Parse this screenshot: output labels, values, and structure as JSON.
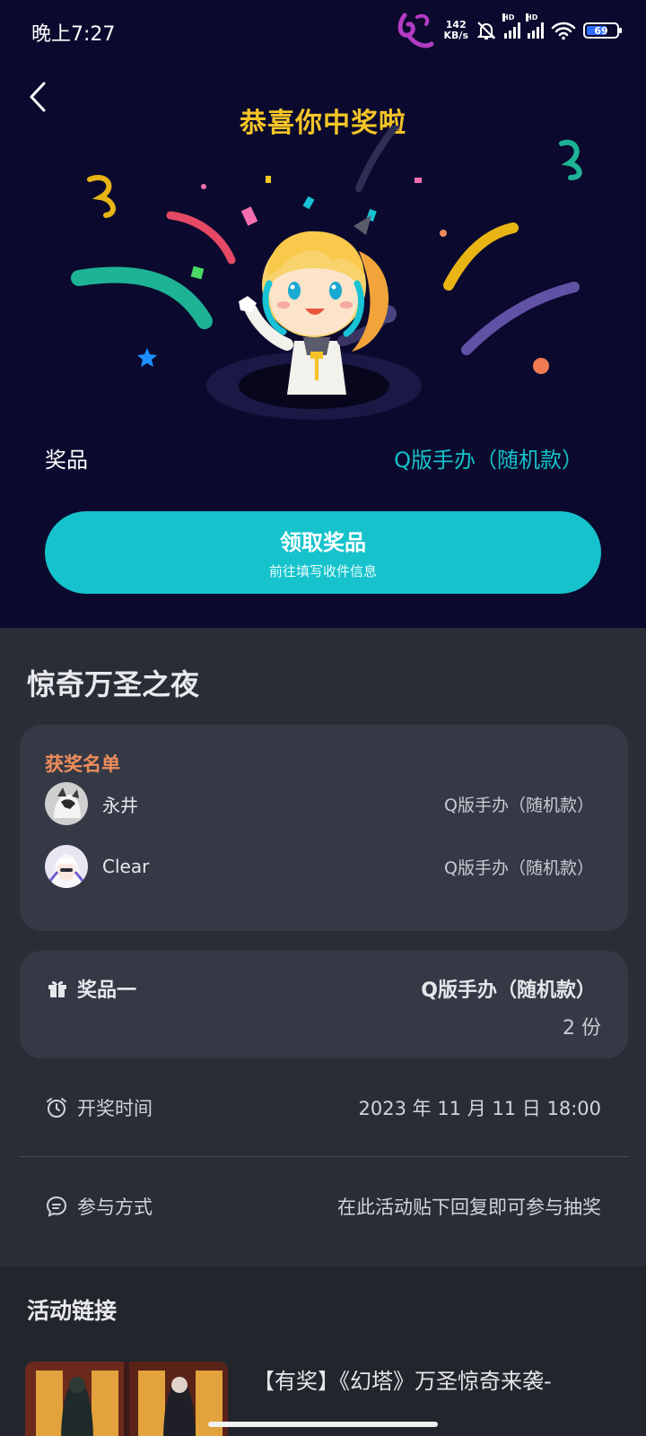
{
  "status_bar": {
    "time": "晚上7:27",
    "net_speed_value": "142",
    "net_speed_unit": "KB/s",
    "signal_label": "HD",
    "battery": "69"
  },
  "hero": {
    "title": "恭喜你中奖啦",
    "prize_label": "奖品",
    "prize_value": "Q版手办（随机款）",
    "claim_button": {
      "label": "领取奖品",
      "sublabel": "前往填写收件信息"
    }
  },
  "event": {
    "title": "惊奇万圣之夜"
  },
  "winners": {
    "heading": "获奖名单",
    "items": [
      {
        "name": "永井",
        "prize": "Q版手办（随机款）"
      },
      {
        "name": "Clear",
        "prize": "Q版手办（随机款）"
      }
    ]
  },
  "prize_card": {
    "name": "奖品一",
    "title": "Q版手办（随机款）",
    "count": "2 份"
  },
  "draw_time": {
    "label": "开奖时间",
    "value": "2023 年 11 月 11 日 18:00"
  },
  "participation": {
    "label": "参与方式",
    "value": "在此活动贴下回复即可参与抽奖"
  },
  "links": {
    "heading": "活动链接",
    "item_title": "【有奖】《幻塔》万圣惊奇来袭-"
  },
  "colors": {
    "hero_bg": "#0b0a2e",
    "accent_gold": "#f5c527",
    "accent_teal": "#16c3cc",
    "winners_heading": "#ee8d5b",
    "card_bg": "#353946",
    "page_bg": "#2a2d36"
  },
  "icons": {
    "back": "chevron-left-icon",
    "gift": "gift-icon",
    "clock": "alarm-clock-icon",
    "participate": "chat-bubble-icon"
  }
}
